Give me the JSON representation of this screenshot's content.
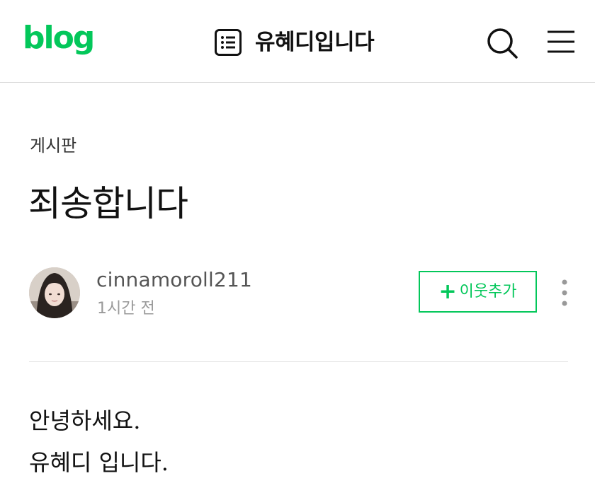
{
  "header": {
    "logo": "blog",
    "blog_title": "유혜디입니다",
    "icons": [
      "list-icon",
      "search-icon",
      "menu-icon"
    ]
  },
  "post": {
    "category": "게시판",
    "title": "죄송합니다",
    "author": {
      "name": "cinnamoroll211",
      "time": "1시간 전"
    },
    "follow_button": {
      "plus": "+",
      "label": "이웃추가"
    },
    "body": [
      "안녕하세요.",
      "유혜디 입니다."
    ]
  },
  "colors": {
    "brand_green": "#03c75a",
    "divider": "#e4e4e4"
  }
}
